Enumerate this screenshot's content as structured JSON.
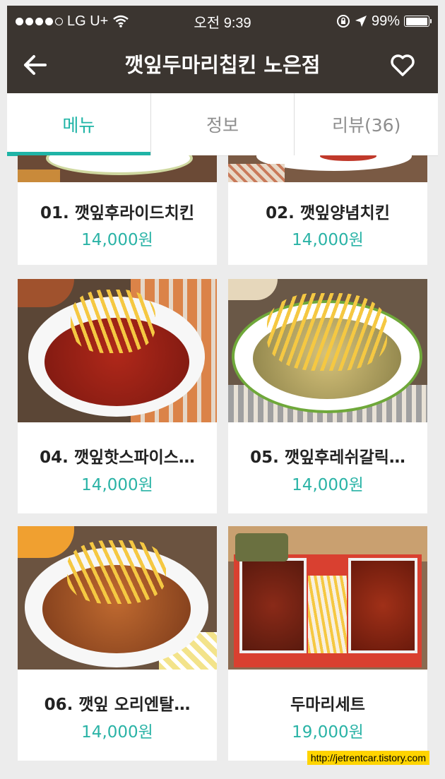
{
  "status_bar": {
    "carrier": "LG U+",
    "time": "오전 9:39",
    "battery": "99%",
    "battery_level": 0.99
  },
  "header": {
    "title": "깻잎두마리칩킨 노은점"
  },
  "tabs": [
    {
      "label": "메뉴",
      "active": true
    },
    {
      "label": "정보",
      "active": false
    },
    {
      "label": "리뷰(36)",
      "active": false
    }
  ],
  "menu_items": [
    {
      "name": "01. 깻잎후라이드치킨",
      "price": "14,000원"
    },
    {
      "name": "02. 깻잎양념치킨",
      "price": "14,000원"
    },
    {
      "name": "04. 깻잎핫스파이스…",
      "price": "14,000원"
    },
    {
      "name": "05. 깻잎후레쉬갈릭…",
      "price": "14,000원"
    },
    {
      "name": "06. 깻잎 오리엔탈…",
      "price": "14,000원"
    },
    {
      "name": "두마리세트",
      "price": "19,000원"
    }
  ],
  "watermark": "http://jetrentcar.tistory.com",
  "colors": {
    "header_bg": "#3b3530",
    "accent": "#1fb4a6",
    "price": "#2ab3a6"
  }
}
